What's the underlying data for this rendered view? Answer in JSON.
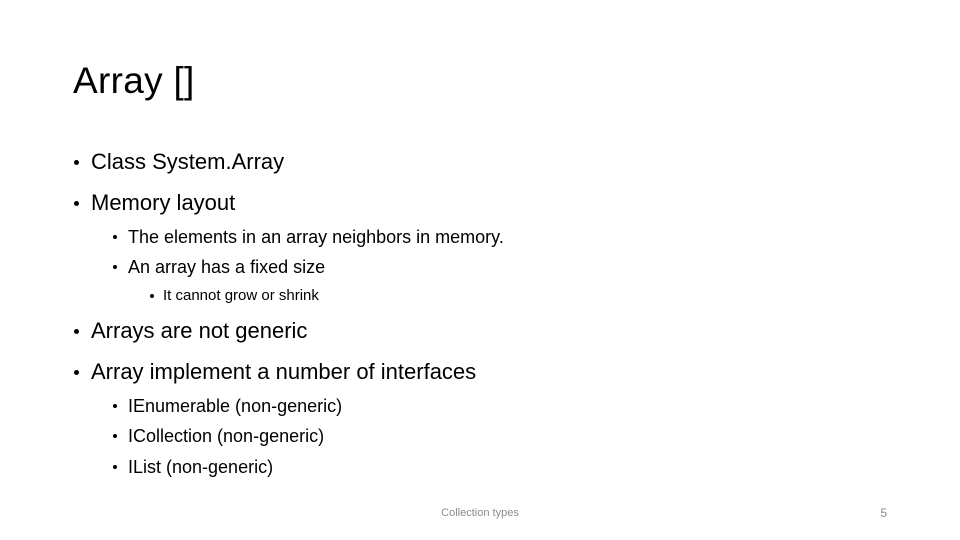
{
  "slide": {
    "title": "Array []",
    "bullets": [
      {
        "level": 1,
        "text": "Class System.Array"
      },
      {
        "level": 1,
        "text": "Memory layout"
      },
      {
        "level": 2,
        "text": "The elements in an array neighbors in memory."
      },
      {
        "level": 2,
        "text": "An array has a fixed size"
      },
      {
        "level": 3,
        "text": "It cannot grow or shrink"
      },
      {
        "level": 1,
        "text": "Arrays are not generic"
      },
      {
        "level": 1,
        "text": "Array implement a number of interfaces"
      },
      {
        "level": 2,
        "text": "IEnumerable (non-generic)"
      },
      {
        "level": 2,
        "text": "ICollection (non-generic)"
      },
      {
        "level": 2,
        "text": "IList (non-generic)"
      }
    ],
    "footer": {
      "center_text": "Collection types",
      "slide_number": "5"
    }
  }
}
